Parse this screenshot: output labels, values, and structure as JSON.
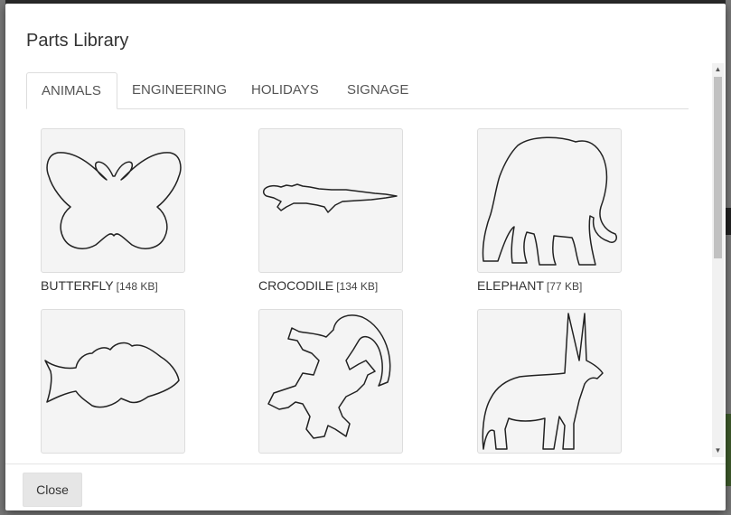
{
  "modal": {
    "title": "Parts Library",
    "close_label": "Close"
  },
  "tabs": [
    {
      "label": "ANIMALS",
      "active": true
    },
    {
      "label": "ENGINEERING",
      "active": false
    },
    {
      "label": "HOLIDAYS",
      "active": false
    },
    {
      "label": "SIGNAGE",
      "active": false
    }
  ],
  "parts": [
    {
      "name": "BUTTERFLY",
      "size": "[148 KB]",
      "icon": "butterfly-icon"
    },
    {
      "name": "CROCODILE",
      "size": "[134 KB]",
      "icon": "crocodile-icon"
    },
    {
      "name": "ELEPHANT",
      "size": "[77 KB]",
      "icon": "elephant-icon"
    },
    {
      "name": "",
      "size": "",
      "icon": "fish-icon"
    },
    {
      "name": "",
      "size": "",
      "icon": "gecko-icon"
    },
    {
      "name": "",
      "size": "",
      "icon": "oryx-icon"
    }
  ],
  "scrollbar": {
    "up_arrow": "▲",
    "down_arrow": "▼"
  }
}
